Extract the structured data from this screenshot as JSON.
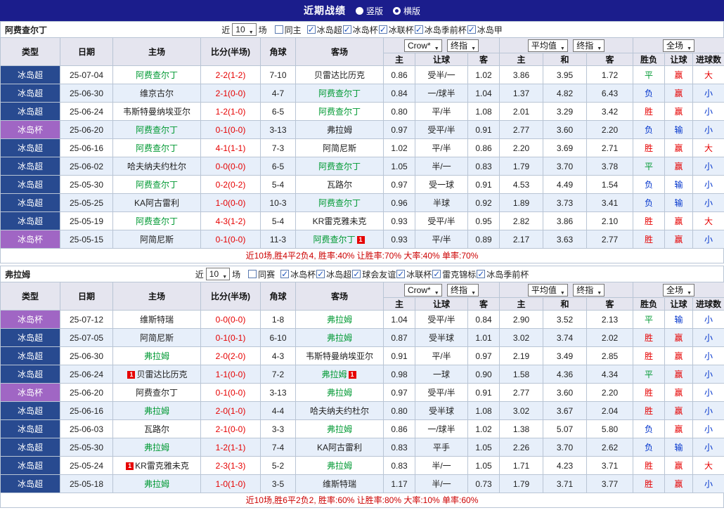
{
  "topbar": {
    "title": "近期战绩",
    "vertical_label": "竖版",
    "horizontal_label": "横版"
  },
  "controls": {
    "near_label": "近",
    "near_value": "10",
    "games_label": "场",
    "asian_source": "Crow*",
    "asian_final": "终指",
    "euro_source": "平均值",
    "euro_final": "终指",
    "scope": "全场"
  },
  "columns": {
    "type": "类型",
    "date": "日期",
    "home": "主场",
    "score": "比分(半场)",
    "corner": "角球",
    "away": "客场",
    "asian_home": "主",
    "asian_handicap": "让球",
    "asian_away": "客",
    "euro_home": "主",
    "euro_draw": "和",
    "euro_away": "客",
    "result": "胜负",
    "handicap_result": "让球",
    "goals": "进球数"
  },
  "colors": {
    "win": "#e60000",
    "draw": "#009933",
    "lose": "#0033cc",
    "super_league_bg": "#284a90",
    "cup_bg": "#a066c4",
    "focus_team": "#009933",
    "topbar_bg": "#1b1d8c"
  },
  "sections": [
    {
      "team": "阿费查尔丁",
      "same_label": "同主",
      "same_checked": false,
      "leagues": [
        "冰岛超",
        "冰岛杯",
        "冰联杯",
        "冰岛季前杯",
        "冰岛甲"
      ],
      "rows": [
        {
          "league": "冰岛超",
          "date": "25-07-04",
          "home": "阿费查尔丁",
          "score": "2-2(1-2)",
          "corner": "7-10",
          "away": "贝雷达比历克",
          "ah": "0.86",
          "hc": "受半/一",
          "aa": "1.02",
          "eh": "3.86",
          "ed": "3.95",
          "ea": "1.72",
          "res": "平",
          "hres": "赢",
          "goals": "大"
        },
        {
          "league": "冰岛超",
          "date": "25-06-30",
          "home": "维京古尔",
          "score": "2-1(0-0)",
          "corner": "4-7",
          "away": "阿费查尔丁",
          "ah": "0.84",
          "hc": "一/球半",
          "aa": "1.04",
          "eh": "1.37",
          "ed": "4.82",
          "ea": "6.43",
          "res": "负",
          "hres": "赢",
          "goals": "小"
        },
        {
          "league": "冰岛超",
          "date": "25-06-24",
          "home": "韦斯特曼纳埃亚尔",
          "score": "1-2(1-0)",
          "corner": "6-5",
          "away": "阿费查尔丁",
          "ah": "0.80",
          "hc": "平/半",
          "aa": "1.08",
          "eh": "2.01",
          "ed": "3.29",
          "ea": "3.42",
          "res": "胜",
          "hres": "赢",
          "goals": "小"
        },
        {
          "league": "冰岛杯",
          "date": "25-06-20",
          "home": "阿费查尔丁",
          "score": "0-1(0-0)",
          "corner": "3-13",
          "away": "弗拉姆",
          "ah": "0.97",
          "hc": "受平/半",
          "aa": "0.91",
          "eh": "2.77",
          "ed": "3.60",
          "ea": "2.20",
          "res": "负",
          "hres": "输",
          "goals": "小"
        },
        {
          "league": "冰岛超",
          "date": "25-06-16",
          "home": "阿费查尔丁",
          "score": "4-1(1-1)",
          "corner": "7-3",
          "away": "阿简尼斯",
          "ah": "1.02",
          "hc": "平/半",
          "aa": "0.86",
          "eh": "2.20",
          "ed": "3.69",
          "ea": "2.71",
          "res": "胜",
          "hres": "赢",
          "goals": "大"
        },
        {
          "league": "冰岛超",
          "date": "25-06-02",
          "home": "哈夫纳夫约杜尔",
          "score": "0-0(0-0)",
          "corner": "6-5",
          "away": "阿费查尔丁",
          "ah": "1.05",
          "hc": "半/一",
          "aa": "0.83",
          "eh": "1.79",
          "ed": "3.70",
          "ea": "3.78",
          "res": "平",
          "hres": "赢",
          "goals": "小"
        },
        {
          "league": "冰岛超",
          "date": "25-05-30",
          "home": "阿费查尔丁",
          "score": "0-2(0-2)",
          "corner": "5-4",
          "away": "瓦路尔",
          "ah": "0.97",
          "hc": "受一球",
          "aa": "0.91",
          "eh": "4.53",
          "ed": "4.49",
          "ea": "1.54",
          "res": "负",
          "hres": "输",
          "goals": "小"
        },
        {
          "league": "冰岛超",
          "date": "25-05-25",
          "home": "KA阿古雷利",
          "score": "1-0(0-0)",
          "corner": "10-3",
          "away": "阿费查尔丁",
          "ah": "0.96",
          "hc": "半球",
          "aa": "0.92",
          "eh": "1.89",
          "ed": "3.73",
          "ea": "3.41",
          "res": "负",
          "hres": "输",
          "goals": "小"
        },
        {
          "league": "冰岛超",
          "date": "25-05-19",
          "home": "阿费查尔丁",
          "score": "4-3(1-2)",
          "corner": "5-4",
          "away": "KR雷克雅未克",
          "ah": "0.93",
          "hc": "受平/半",
          "aa": "0.95",
          "eh": "2.82",
          "ed": "3.86",
          "ea": "2.10",
          "res": "胜",
          "hres": "赢",
          "goals": "大"
        },
        {
          "league": "冰岛杯",
          "date": "25-05-15",
          "home": "阿简尼斯",
          "score": "0-1(0-0)",
          "corner": "11-3",
          "away": "阿费查尔丁",
          "away_badge": "1",
          "ah": "0.93",
          "hc": "平/半",
          "aa": "0.89",
          "eh": "2.17",
          "ed": "3.63",
          "ea": "2.77",
          "res": "胜",
          "hres": "赢",
          "goals": "小"
        }
      ],
      "summary": "近10场,胜4平2负4, 胜率:40% 让胜率:70% 大率:40% 单率:70%"
    },
    {
      "team": "弗拉姆",
      "same_label": "同赛",
      "same_checked": false,
      "leagues": [
        "冰岛杯",
        "冰岛超",
        "球会友谊",
        "冰联杯",
        "雷克锦标",
        "冰岛季前杯"
      ],
      "rows": [
        {
          "league": "冰岛杯",
          "date": "25-07-12",
          "home": "维斯特瑞",
          "score": "0-0(0-0)",
          "corner": "1-8",
          "away": "弗拉姆",
          "ah": "1.04",
          "hc": "受平/半",
          "aa": "0.84",
          "eh": "2.90",
          "ed": "3.52",
          "ea": "2.13",
          "res": "平",
          "hres": "输",
          "goals": "小"
        },
        {
          "league": "冰岛超",
          "date": "25-07-05",
          "home": "阿简尼斯",
          "score": "0-1(0-1)",
          "corner": "6-10",
          "away": "弗拉姆",
          "ah": "0.87",
          "hc": "受半球",
          "aa": "1.01",
          "eh": "3.02",
          "ed": "3.74",
          "ea": "2.02",
          "res": "胜",
          "hres": "赢",
          "goals": "小"
        },
        {
          "league": "冰岛超",
          "date": "25-06-30",
          "home": "弗拉姆",
          "score": "2-0(2-0)",
          "corner": "4-3",
          "away": "韦斯特曼纳埃亚尔",
          "ah": "0.91",
          "hc": "平/半",
          "aa": "0.97",
          "eh": "2.19",
          "ed": "3.49",
          "ea": "2.85",
          "res": "胜",
          "hres": "赢",
          "goals": "小"
        },
        {
          "league": "冰岛超",
          "date": "25-06-24",
          "home": "贝雷达比历克",
          "home_badge": "1",
          "score": "1-1(0-0)",
          "corner": "7-2",
          "away": "弗拉姆",
          "away_badge": "1",
          "ah": "0.98",
          "hc": "一球",
          "aa": "0.90",
          "eh": "1.58",
          "ed": "4.36",
          "ea": "4.34",
          "res": "平",
          "hres": "赢",
          "goals": "小"
        },
        {
          "league": "冰岛杯",
          "date": "25-06-20",
          "home": "阿费查尔丁",
          "score": "0-1(0-0)",
          "corner": "3-13",
          "away": "弗拉姆",
          "ah": "0.97",
          "hc": "受平/半",
          "aa": "0.91",
          "eh": "2.77",
          "ed": "3.60",
          "ea": "2.20",
          "res": "胜",
          "hres": "赢",
          "goals": "小"
        },
        {
          "league": "冰岛超",
          "date": "25-06-16",
          "home": "弗拉姆",
          "score": "2-0(1-0)",
          "corner": "4-4",
          "away": "哈夫纳夫约杜尔",
          "ah": "0.80",
          "hc": "受半球",
          "aa": "1.08",
          "eh": "3.02",
          "ed": "3.67",
          "ea": "2.04",
          "res": "胜",
          "hres": "赢",
          "goals": "小"
        },
        {
          "league": "冰岛超",
          "date": "25-06-03",
          "home": "瓦路尔",
          "score": "2-1(0-0)",
          "corner": "3-3",
          "away": "弗拉姆",
          "ah": "0.86",
          "hc": "一/球半",
          "aa": "1.02",
          "eh": "1.38",
          "ed": "5.07",
          "ea": "5.80",
          "res": "负",
          "hres": "赢",
          "goals": "小"
        },
        {
          "league": "冰岛超",
          "date": "25-05-30",
          "home": "弗拉姆",
          "score": "1-2(1-1)",
          "corner": "7-4",
          "away": "KA阿古雷利",
          "ah": "0.83",
          "hc": "平手",
          "aa": "1.05",
          "eh": "2.26",
          "ed": "3.70",
          "ea": "2.62",
          "res": "负",
          "hres": "输",
          "goals": "小"
        },
        {
          "league": "冰岛超",
          "date": "25-05-24",
          "home": "KR雷克雅未克",
          "home_badge": "1",
          "score": "2-3(1-3)",
          "corner": "5-2",
          "away": "弗拉姆",
          "ah": "0.83",
          "hc": "半/一",
          "aa": "1.05",
          "eh": "1.71",
          "ed": "4.23",
          "ea": "3.71",
          "res": "胜",
          "hres": "赢",
          "goals": "大"
        },
        {
          "league": "冰岛超",
          "date": "25-05-18",
          "home": "弗拉姆",
          "score": "1-0(1-0)",
          "corner": "3-5",
          "away": "维斯特瑞",
          "ah": "1.17",
          "hc": "半/一",
          "aa": "0.73",
          "eh": "1.79",
          "ed": "3.71",
          "ea": "3.77",
          "res": "胜",
          "hres": "赢",
          "goals": "小"
        }
      ],
      "summary": "近10场,胜6平2负2, 胜率:60% 让胜率:80% 大率:10% 单率:60%"
    }
  ]
}
